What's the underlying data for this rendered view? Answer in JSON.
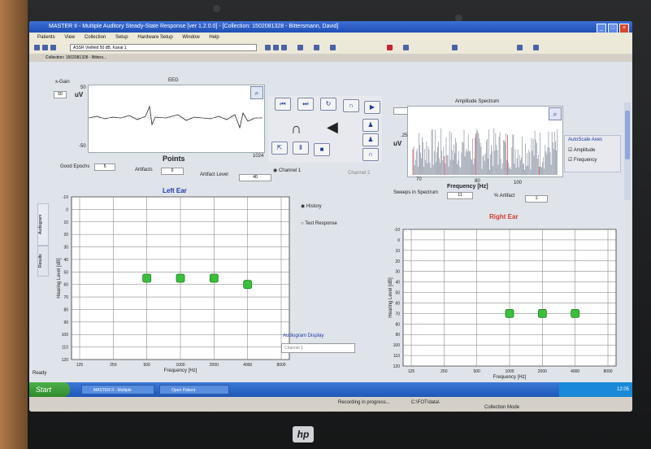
{
  "window": {
    "title": "MASTER II - Multiple Auditory Steady-State Response [ver 1.2.0.0] - [Collection: 1502081328 - Bittersmann, David]",
    "collection_tab": "Collection: 1502081328 - Bitters..."
  },
  "menu": [
    "Patients",
    "View",
    "Collection",
    "Setup",
    "Hardware Setup",
    "Window",
    "Help"
  ],
  "toolbar": {
    "stimulus_field": "ASSR Vielfeld 50 dB, Kanal 1"
  },
  "eeg": {
    "title": "EEG",
    "unit": "uV",
    "scale_value": "50",
    "scale_caption": "x-Gain",
    "ytick_top": "50",
    "ytick_bottom": "-50",
    "x_end": "1024",
    "points_label": "Points",
    "good_epochs_label": "Good Epochs",
    "good_epochs_value": "5",
    "artifacts_label": "Artifacts",
    "artifacts_value": "0",
    "artifact_level_label": "Artifact Level",
    "artifact_level_value": "40"
  },
  "controls": {
    "channel1_label": "Channel 1",
    "channel2_label": "Channel 2"
  },
  "amplitude_spectrum": {
    "title": "Amplitude Spectrum",
    "unit": "uV",
    "y_max": ".25",
    "x_start": "70",
    "x_mid": "80",
    "x_end": "100",
    "xlabel": "Frequency [Hz]",
    "sweeps_label": "Sweeps in Spectrum",
    "sweeps_value": "11",
    "artifact_label": "% Artifact",
    "artifact_value": "1"
  },
  "autoscale": {
    "title": "AutoScale Axes",
    "amplitude_label": "Amplitude",
    "frequency_label": "Frequency"
  },
  "left_tabs": [
    "Audiogram",
    "Results"
  ],
  "view_options": {
    "history_label": "History",
    "test_response_label": "Test Response"
  },
  "audiogram_display": {
    "label": "Audiogram Display",
    "value": "Channel 1"
  },
  "colors": {
    "marker_fill": "#39c03a",
    "left_ear_title": "#1c3aa8",
    "right_ear_title": "#d23a30"
  },
  "chart_data": [
    {
      "type": "scatter",
      "title": "Left Ear",
      "xlabel": "Frequency [Hz]",
      "ylabel": "Hearing Level [dB]",
      "xticks": [
        "125",
        "250",
        "500",
        "1000",
        "2000",
        "4000",
        "8000"
      ],
      "yticks": [
        "0",
        "10",
        "20",
        "30",
        "40",
        "50",
        "60",
        "70",
        "80",
        "90",
        "100",
        "110",
        "120"
      ],
      "ytick_top_extra": "-10",
      "x_scale": "log",
      "ylim": [
        -10,
        120
      ],
      "y_inverted": true,
      "grid": true,
      "series": [
        {
          "x": [
            500,
            1000,
            2000,
            4000
          ],
          "y": [
            55,
            55,
            55,
            60
          ]
        }
      ]
    },
    {
      "type": "scatter",
      "title": "Right Ear",
      "xlabel": "Frequency [Hz]",
      "ylabel": "Hearing Level [dB]",
      "xticks": [
        "125",
        "250",
        "500",
        "1000",
        "2000",
        "4000",
        "8000"
      ],
      "yticks": [
        "0",
        "10",
        "20",
        "30",
        "40",
        "50",
        "60",
        "70",
        "80",
        "90",
        "100",
        "110",
        "120"
      ],
      "ytick_top_extra": "-10",
      "x_scale": "log",
      "ylim": [
        -10,
        120
      ],
      "y_inverted": true,
      "grid": true,
      "series": [
        {
          "x": [
            1000,
            2000,
            4000
          ],
          "y": [
            70,
            70,
            70
          ]
        }
      ]
    }
  ],
  "taskbar": {
    "start_label": "Start",
    "items": [
      "MASTER II - Multiple",
      "Open Patient"
    ],
    "clock": "12:05"
  },
  "statusbar": {
    "ready": "Ready",
    "recording": "Recording in progress...",
    "path": "C:\\FOT\\data\\",
    "mode": "Collection Mode"
  },
  "logo_text": "hp"
}
